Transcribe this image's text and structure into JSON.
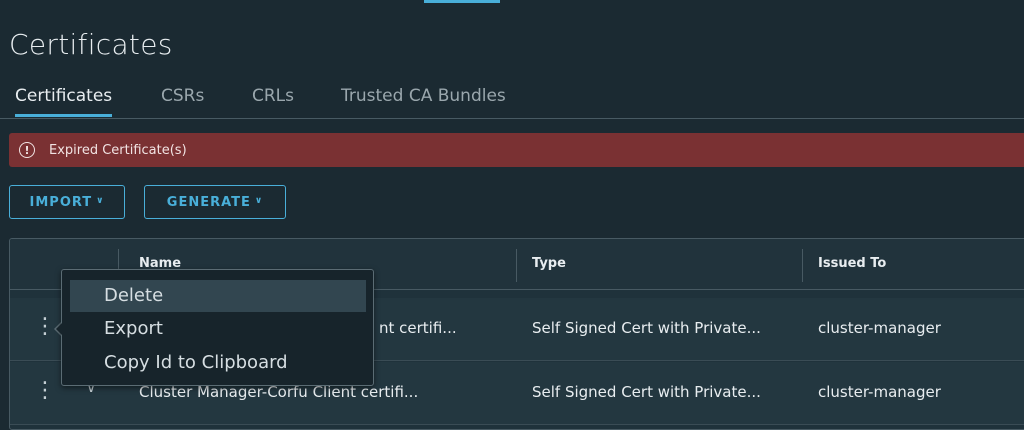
{
  "page": {
    "title": "Certificates"
  },
  "tabs": [
    "Certificates",
    "CSRs",
    "CRLs",
    "Trusted CA Bundles"
  ],
  "alert": {
    "message": "Expired Certificate(s)"
  },
  "actions": {
    "import_label": "IMPORT",
    "generate_label": "GENERATE"
  },
  "grid": {
    "columns": [
      "Name",
      "Type",
      "Issued To"
    ],
    "rows": [
      {
        "name": "Cluster Manager-Corfu Client certifi...",
        "type": "Self Signed Cert with Private...",
        "issued_to": "cluster-manager"
      },
      {
        "name": "Cluster Manager-Corfu Client certifi...",
        "type": "Self Signed Cert with Private...",
        "issued_to": "cluster-manager"
      }
    ],
    "visible_name_fragment": "nt certifi..."
  },
  "context_menu": {
    "items": [
      "Delete",
      "Export",
      "Copy Id to Clipboard"
    ]
  },
  "colors": {
    "background": "#1b2a32",
    "accent": "#49afd9",
    "alert": "#7a3133",
    "text": "#e8edf0"
  }
}
